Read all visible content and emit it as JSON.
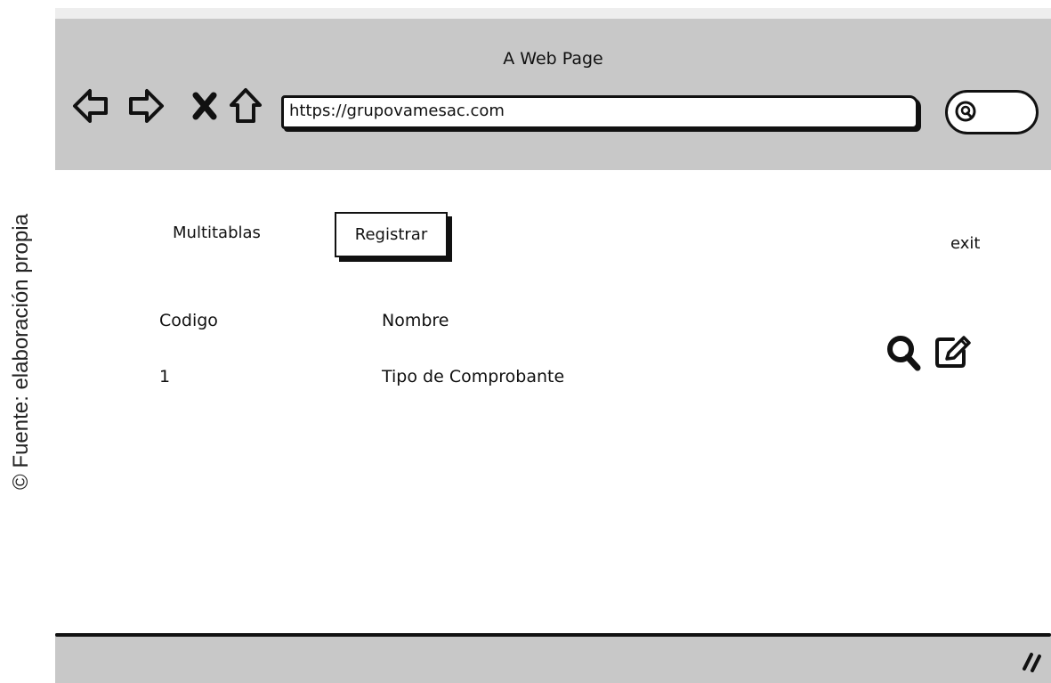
{
  "credit": "© Fuente: elaboración propia",
  "browser": {
    "title": "A Web Page",
    "url": "https://grupovamesac.com",
    "icons": [
      "back-arrow-icon",
      "forward-arrow-icon",
      "close-x-icon",
      "home-icon",
      "search-icon"
    ]
  },
  "menu": {
    "multitablas_label": "Multitablas",
    "registrar_label": "Registrar",
    "exit_label": "exit"
  },
  "table": {
    "columns": [
      "Codigo",
      "Nombre"
    ],
    "rows": [
      {
        "codigo": "1",
        "nombre": "Tipo de Comprobante",
        "actions": [
          "search-icon",
          "edit-icon"
        ]
      }
    ]
  },
  "colors": {
    "chrome": "#c8c8c8",
    "stroke": "#111111",
    "background": "#ffffff"
  }
}
